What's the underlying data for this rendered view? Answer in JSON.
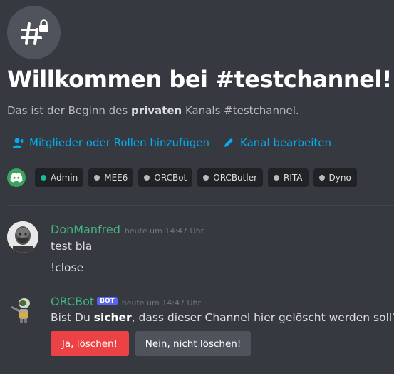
{
  "welcome": {
    "title": "Willkommen bei #testchannel!",
    "sub_prefix": "Das ist der Beginn des ",
    "sub_bold": "privaten",
    "sub_suffix": " Kanals #testchannel."
  },
  "actions": {
    "add_members_label": "Mitglieder oder Rollen hinzufügen",
    "edit_channel_label": "Kanal bearbeiten"
  },
  "roles": [
    {
      "name": "Admin",
      "color": "#1abc9c"
    },
    {
      "name": "MEE6",
      "color": "#b9bbbe"
    },
    {
      "name": "ORCBot",
      "color": "#b9bbbe"
    },
    {
      "name": "ORCButler",
      "color": "#b9bbbe"
    },
    {
      "name": "RITA",
      "color": "#b9bbbe"
    },
    {
      "name": "Dyno",
      "color": "#b9bbbe"
    }
  ],
  "messages": [
    {
      "author": "DonManfred",
      "timestamp": "heute um 14:47 Uhr",
      "lines": [
        "test bla",
        "!close"
      ]
    },
    {
      "author": "ORCBot",
      "bot_tag": "BOT",
      "timestamp": "heute um 14:47 Uhr",
      "text_prefix": "Bist Du ",
      "text_bold": "sicher",
      "text_suffix": ", dass dieser Channel hier gelöscht werden soll?",
      "buttons": {
        "confirm": "Ja, löschen!",
        "cancel": "Nein, nicht löschen!"
      }
    }
  ],
  "colors": {
    "background": "#36393f",
    "link": "#00aff4",
    "author": "#43b581",
    "danger": "#ed4245",
    "bot_tag": "#5865f2"
  }
}
